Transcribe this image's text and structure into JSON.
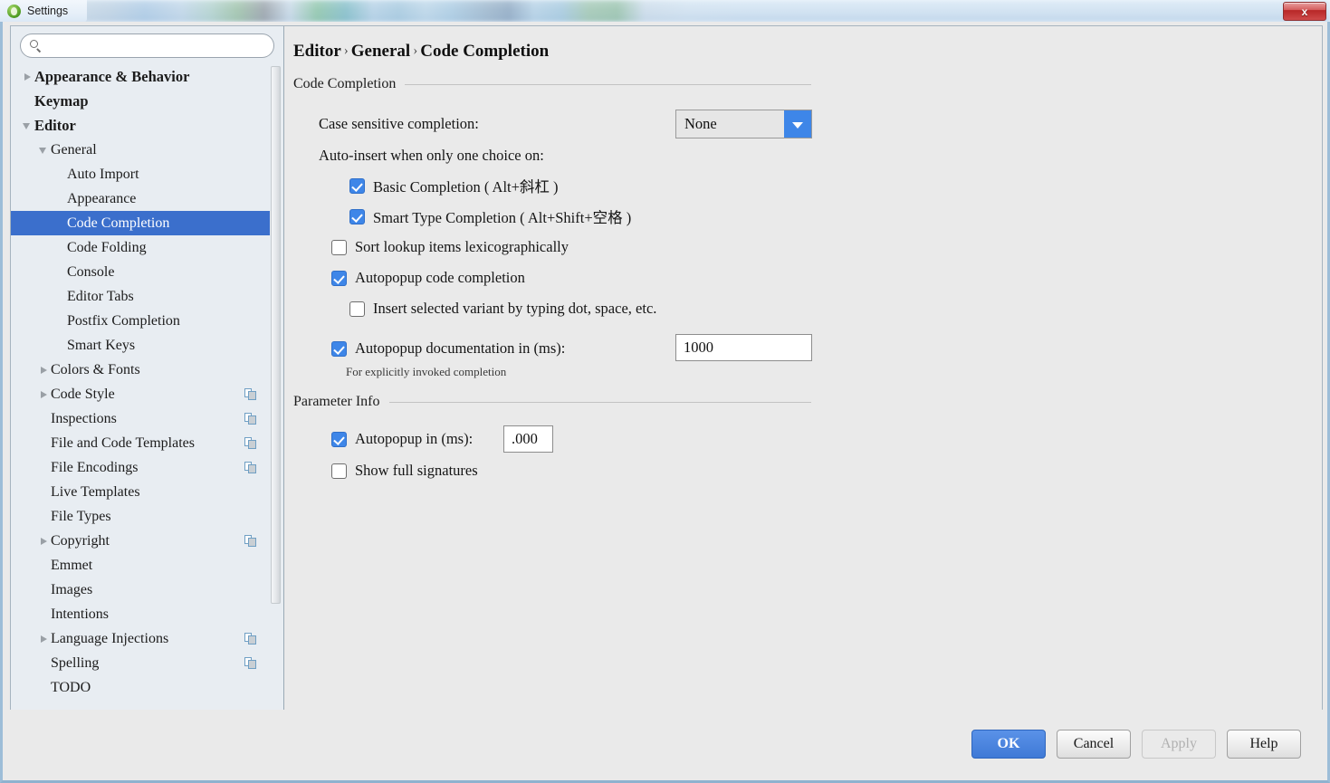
{
  "window": {
    "title": "Settings",
    "app_icon": "android-studio-icon",
    "close_label": "x"
  },
  "sidebar": {
    "search": {
      "value": "",
      "placeholder": "",
      "icon": "search-icon"
    },
    "items": [
      {
        "label": "Appearance & Behavior",
        "level": 0,
        "twisty": "collapsed",
        "scope_icon": false,
        "selected": false
      },
      {
        "label": "Keymap",
        "level": 0,
        "twisty": "none",
        "scope_icon": false,
        "selected": false
      },
      {
        "label": "Editor",
        "level": 0,
        "twisty": "expanded",
        "scope_icon": false,
        "selected": false
      },
      {
        "label": "General",
        "level": 1,
        "twisty": "expanded",
        "scope_icon": false,
        "selected": false
      },
      {
        "label": "Auto Import",
        "level": 2,
        "twisty": "none",
        "scope_icon": false,
        "selected": false
      },
      {
        "label": "Appearance",
        "level": 2,
        "twisty": "none",
        "scope_icon": false,
        "selected": false
      },
      {
        "label": "Code Completion",
        "level": 2,
        "twisty": "none",
        "scope_icon": false,
        "selected": true
      },
      {
        "label": "Code Folding",
        "level": 2,
        "twisty": "none",
        "scope_icon": false,
        "selected": false
      },
      {
        "label": "Console",
        "level": 2,
        "twisty": "none",
        "scope_icon": false,
        "selected": false
      },
      {
        "label": "Editor Tabs",
        "level": 2,
        "twisty": "none",
        "scope_icon": false,
        "selected": false
      },
      {
        "label": "Postfix Completion",
        "level": 2,
        "twisty": "none",
        "scope_icon": false,
        "selected": false
      },
      {
        "label": "Smart Keys",
        "level": 2,
        "twisty": "none",
        "scope_icon": false,
        "selected": false
      },
      {
        "label": "Colors & Fonts",
        "level": 1,
        "twisty": "collapsed",
        "scope_icon": false,
        "selected": false
      },
      {
        "label": "Code Style",
        "level": 1,
        "twisty": "collapsed",
        "scope_icon": true,
        "selected": false
      },
      {
        "label": "Inspections",
        "level": 1,
        "twisty": "none",
        "scope_icon": true,
        "selected": false
      },
      {
        "label": "File and Code Templates",
        "level": 1,
        "twisty": "none",
        "scope_icon": true,
        "selected": false
      },
      {
        "label": "File Encodings",
        "level": 1,
        "twisty": "none",
        "scope_icon": true,
        "selected": false
      },
      {
        "label": "Live Templates",
        "level": 1,
        "twisty": "none",
        "scope_icon": false,
        "selected": false
      },
      {
        "label": "File Types",
        "level": 1,
        "twisty": "none",
        "scope_icon": false,
        "selected": false
      },
      {
        "label": "Copyright",
        "level": 1,
        "twisty": "collapsed",
        "scope_icon": true,
        "selected": false
      },
      {
        "label": "Emmet",
        "level": 1,
        "twisty": "none",
        "scope_icon": false,
        "selected": false
      },
      {
        "label": "Images",
        "level": 1,
        "twisty": "none",
        "scope_icon": false,
        "selected": false
      },
      {
        "label": "Intentions",
        "level": 1,
        "twisty": "none",
        "scope_icon": false,
        "selected": false
      },
      {
        "label": "Language Injections",
        "level": 1,
        "twisty": "collapsed",
        "scope_icon": true,
        "selected": false
      },
      {
        "label": "Spelling",
        "level": 1,
        "twisty": "none",
        "scope_icon": true,
        "selected": false
      },
      {
        "label": "TODO",
        "level": 1,
        "twisty": "none",
        "scope_icon": false,
        "selected": false
      }
    ]
  },
  "main": {
    "breadcrumb": {
      "part1": "Editor",
      "sep1": "›",
      "part2": "General",
      "sep2": "›",
      "part3": "Code Completion"
    },
    "group_code_completion": {
      "title": "Code Completion",
      "case_sensitive_label": "Case sensitive completion:",
      "case_sensitive_value": "None",
      "auto_insert_label": "Auto-insert when only one choice on:",
      "basic_completion_label": "Basic Completion ( Alt+斜杠 )",
      "basic_completion_checked": true,
      "smart_type_label": "Smart Type Completion ( Alt+Shift+空格 )",
      "smart_type_checked": true,
      "sort_lookup_label": "Sort lookup items lexicographically",
      "sort_lookup_checked": false,
      "autopopup_code_label": "Autopopup code completion",
      "autopopup_code_checked": true,
      "insert_variant_label": "Insert selected variant by typing dot, space, etc.",
      "insert_variant_checked": false,
      "autopopup_doc_label": "Autopopup documentation in (ms):",
      "autopopup_doc_checked": true,
      "autopopup_doc_value": "1000",
      "autopopup_doc_hint": "For explicitly invoked completion"
    },
    "group_parameter_info": {
      "title": "Parameter Info",
      "autopopup_label": "Autopopup in (ms):",
      "autopopup_checked": true,
      "autopopup_value": ".000",
      "show_signatures_label": "Show full signatures",
      "show_signatures_checked": false
    }
  },
  "footer": {
    "ok": "OK",
    "cancel": "Cancel",
    "apply": "Apply",
    "help": "Help"
  },
  "colors": {
    "accent": "#3e86e8",
    "selection": "#3b6fcc",
    "dialog_bg": "#eaeaea",
    "sidebar_bg": "#e8edf2",
    "close_red": "#b72727"
  }
}
